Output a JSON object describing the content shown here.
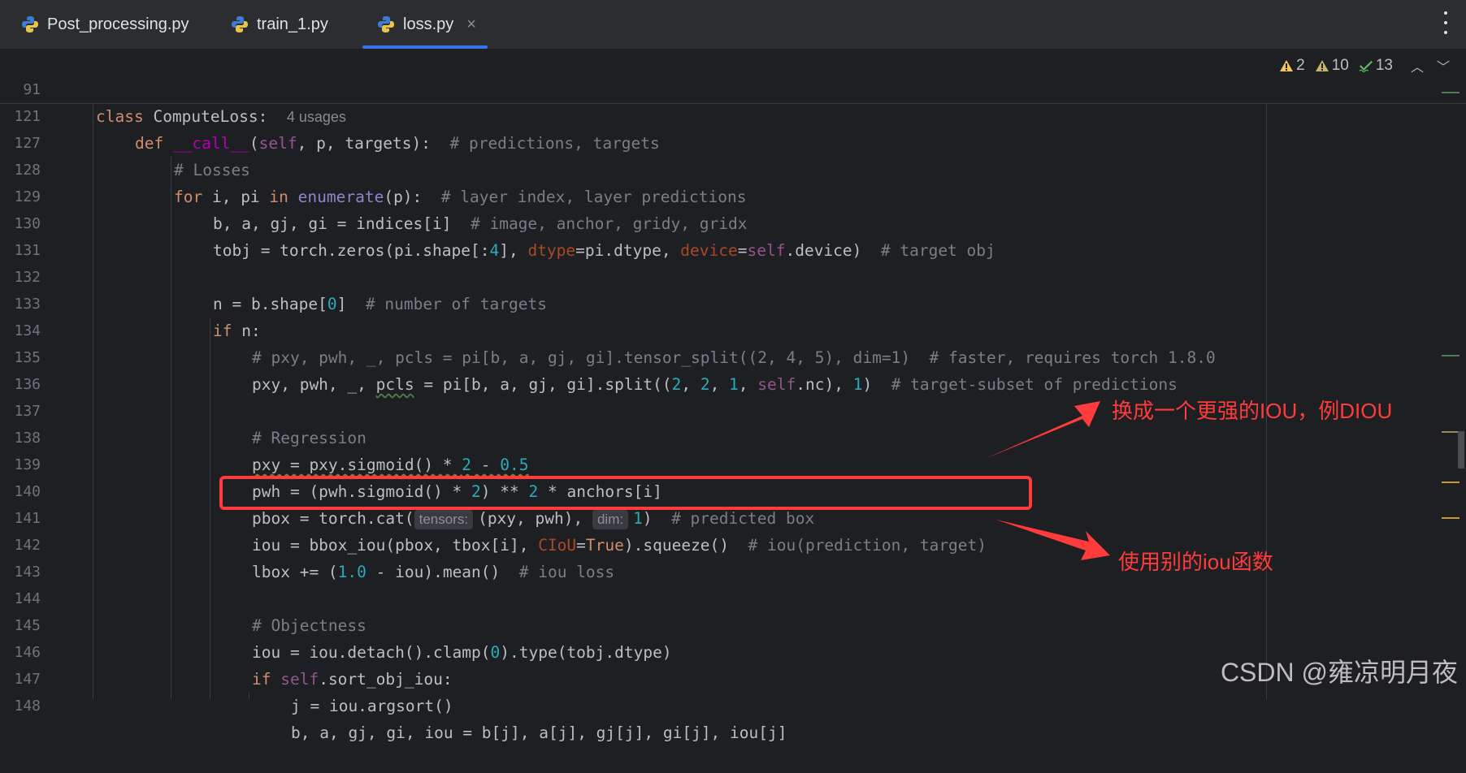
{
  "tabs": [
    {
      "label": "Post_processing.py",
      "active": false
    },
    {
      "label": "train_1.py",
      "active": false
    },
    {
      "label": "loss.py",
      "active": true
    }
  ],
  "tab_close_glyph": "×",
  "inspections": {
    "warnings_strong": "2",
    "warnings_weak": "10",
    "checks": "13"
  },
  "sticky": {
    "l91": {
      "num": "91",
      "kw": "class",
      "name": "ComputeLoss:",
      "usages": "4 usages"
    },
    "l121": {
      "num": "121",
      "kw": "def",
      "fn": "__call__",
      "open": "(",
      "self": "self",
      "rest": ", p, targets):",
      "comment": "# predictions, targets"
    }
  },
  "lines": {
    "l127": {
      "num": "127",
      "comment": "# Losses"
    },
    "l128": {
      "num": "128",
      "kw1": "for",
      "a": " i, pi ",
      "kw2": "in",
      "b": " ",
      "bi": "enumerate",
      "c": "(p):  ",
      "comment": "# layer index, layer predictions"
    },
    "l129": {
      "num": "129",
      "a": "b, a, gj, gi = indices[i]  ",
      "comment": "# image, anchor, gridy, gridx"
    },
    "l130": {
      "num": "130",
      "a": "tobj = torch.zeros(pi.shape[:",
      "n1": "4",
      "b": "], ",
      "k1": "dtype",
      "c": "=pi.dtype, ",
      "k2": "device",
      "d": "=",
      "self": "self",
      "e": ".device)  ",
      "comment": "# target obj"
    },
    "l131": {
      "num": "131"
    },
    "l132": {
      "num": "132",
      "a": "n = b.shape[",
      "n1": "0",
      "b": "]  ",
      "comment": "# number of targets"
    },
    "l133": {
      "num": "133",
      "kw": "if",
      "a": " n:"
    },
    "l134": {
      "num": "134",
      "comment": "# pxy, pwh, _, pcls = pi[b, a, gj, gi].tensor_split((2, 4, 5), dim=1)  # faster, requires torch 1.8.0"
    },
    "l135": {
      "num": "135",
      "a": "pxy, pwh, _, ",
      "w": "pcls",
      "b": " = pi[b, a, gj, gi].split((",
      "n1": "2",
      "c": ", ",
      "n2": "2",
      "d": ", ",
      "n3": "1",
      "e": ", ",
      "self": "self",
      "f": ".nc), ",
      "n4": "1",
      "g": ")  ",
      "comment": "# target-subset of predictions"
    },
    "l136": {
      "num": "136"
    },
    "l137": {
      "num": "137",
      "comment": "# Regression"
    },
    "l138": {
      "num": "138",
      "w": "pxy = pxy.sigmoid() * ",
      "n1": "2",
      "a": " - ",
      "n2": "0.5"
    },
    "l139": {
      "num": "139",
      "a": "pwh = (pwh.sigmoid() * ",
      "n1": "2",
      "b": ") ** ",
      "n2": "2",
      "c": " * anchors[i]"
    },
    "l140": {
      "num": "140",
      "a": "pbox = torch.cat(",
      "h1": "tensors:",
      "b": "(pxy, pwh), ",
      "h2": "dim:",
      "n1": "1",
      "c": ")  ",
      "comment": "# predicted box"
    },
    "l141": {
      "num": "141",
      "a": "iou = bbox_iou(pbox, tbox[i], ",
      "k1": "CIoU",
      "b": "=",
      "kw": "True",
      "c": ").squeeze()  ",
      "comment": "# iou(prediction, target)"
    },
    "l142": {
      "num": "142",
      "a": "lbox += (",
      "n1": "1.0",
      "b": " - iou).mean()  ",
      "comment": "# iou loss"
    },
    "l143": {
      "num": "143"
    },
    "l144": {
      "num": "144",
      "comment": "# Objectness"
    },
    "l145": {
      "num": "145",
      "a": "iou = iou.detach().clamp(",
      "n1": "0",
      "b": ").type(tobj.dtype)"
    },
    "l146": {
      "num": "146",
      "kw": "if",
      "a": " ",
      "self": "self",
      "b": ".sort_obj_iou:"
    },
    "l147": {
      "num": "147",
      "a": "j = iou.argsort()"
    },
    "l148": {
      "num": "148",
      "a": "b, a, gj, gi, iou = b[j], a[j], gj[j], gi[j], iou[j]"
    }
  },
  "annotations": {
    "top": "换成一个更强的IOU，例DIOU",
    "bottom": "使用别的iou函数"
  },
  "watermark": "CSDN @雍凉明月夜",
  "colors": {
    "annotation": "#ff3b3b",
    "active_tab_underline": "#3574f0"
  }
}
